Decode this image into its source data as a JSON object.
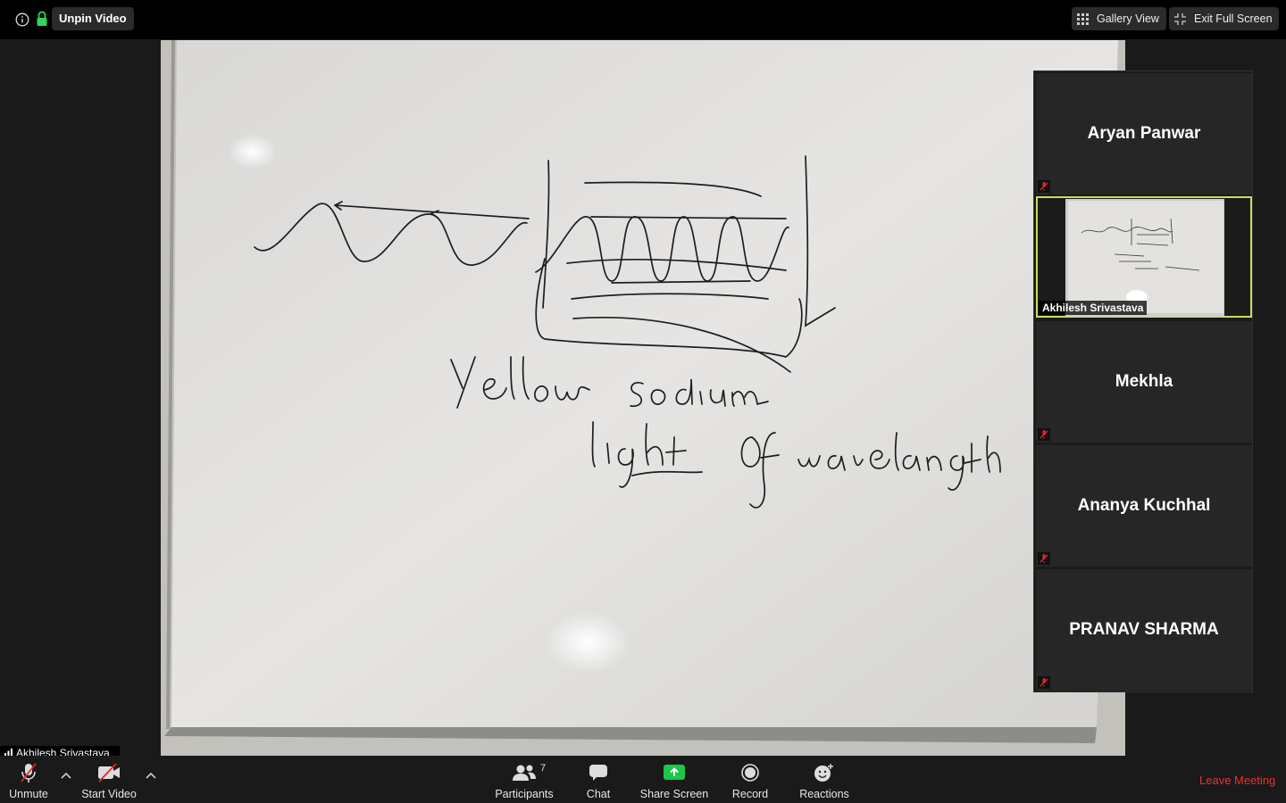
{
  "topbar": {
    "unpin_label": "Unpin Video",
    "gallery_label": "Gallery View",
    "exit_fullscreen_label": "Exit Full Screen"
  },
  "main_video": {
    "speaker_name": "Akhilesh Srivastava",
    "whiteboard_text": [
      "Yellow sodium",
      "light of wavelength"
    ]
  },
  "tiles": [
    {
      "name": "Aryan Panwar",
      "muted": true
    },
    {
      "name": "Akhilesh Srivastava",
      "active": true,
      "video": true
    },
    {
      "name": "Mekhla",
      "muted": true
    },
    {
      "name": "Ananya Kuchhal",
      "muted": true
    },
    {
      "name": "PRANAV SHARMA",
      "muted": true
    }
  ],
  "toolbar": {
    "unmute_label": "Unmute",
    "start_video_label": "Start Video",
    "participants_label": "Participants",
    "participants_count": "7",
    "chat_label": "Chat",
    "share_label": "Share Screen",
    "record_label": "Record",
    "reactions_label": "Reactions",
    "leave_label": "Leave Meeting"
  },
  "colors": {
    "active_border": "#c6e05a",
    "share_green": "#1ec64a",
    "leave_red": "#e5332a",
    "muted_red": "#e02828",
    "lock_green": "#2fd35f"
  },
  "icons": [
    "info-icon",
    "lock-icon",
    "grid-icon",
    "exit-fullscreen-icon",
    "mic-muted-icon",
    "video-off-icon",
    "participants-icon",
    "chat-icon",
    "share-screen-icon",
    "record-icon",
    "reactions-icon"
  ]
}
